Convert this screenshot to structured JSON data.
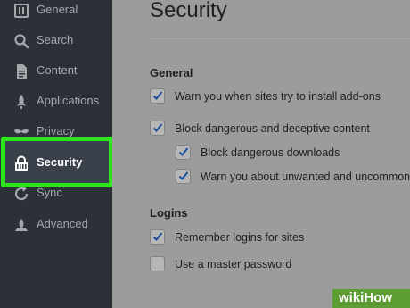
{
  "sidebar": {
    "items": [
      {
        "label": "General",
        "icon": "general-icon"
      },
      {
        "label": "Search",
        "icon": "search-icon"
      },
      {
        "label": "Content",
        "icon": "content-icon"
      },
      {
        "label": "Applications",
        "icon": "applications-icon"
      },
      {
        "label": "Privacy",
        "icon": "privacy-icon"
      },
      {
        "label": "Security",
        "icon": "lock-icon",
        "active": true
      },
      {
        "label": "Sync",
        "icon": "sync-icon"
      },
      {
        "label": "Advanced",
        "icon": "advanced-icon"
      }
    ],
    "highlight_color": "#2de51d"
  },
  "main": {
    "title": "Security",
    "general": {
      "heading": "General",
      "items": [
        {
          "label": "Warn you when sites try to install add-ons",
          "checked": true
        },
        {
          "label": "Block dangerous and deceptive content",
          "checked": true
        },
        {
          "label": "Block dangerous downloads",
          "checked": true
        },
        {
          "label": "Warn you about unwanted and uncommon s",
          "checked": true
        }
      ]
    },
    "logins": {
      "heading": "Logins",
      "items": [
        {
          "label": "Remember logins for sites",
          "checked": true
        },
        {
          "label": "Use a master password",
          "checked": false
        }
      ]
    }
  },
  "watermark": {
    "text": "wikiHow"
  }
}
